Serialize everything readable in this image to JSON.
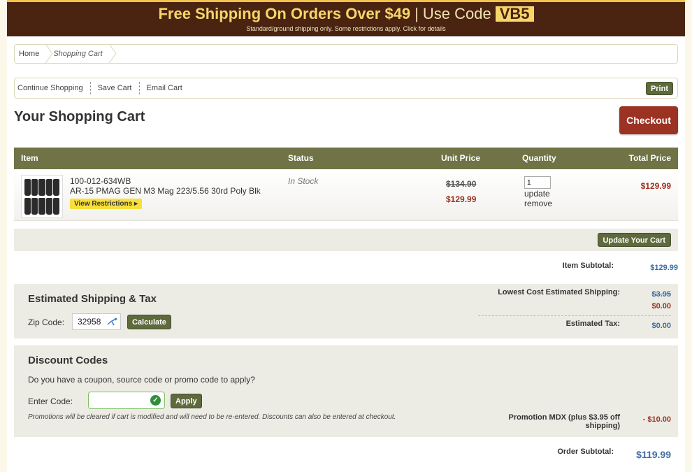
{
  "banner": {
    "headline": "Free Shipping On Orders Over $49",
    "separator": "|",
    "code_label": "Use Code",
    "code": "VB5",
    "subtext": "Standard/ground shipping only. Some restrictions apply. Click for details"
  },
  "breadcrumb": {
    "home": "Home",
    "current": "Shopping Cart"
  },
  "toolbar": {
    "continue": "Continue Shopping",
    "save": "Save Cart",
    "email": "Email Cart",
    "print": "Print"
  },
  "page_title": "Your Shopping Cart",
  "checkout_label": "Checkout",
  "table": {
    "headers": {
      "item": "Item",
      "status": "Status",
      "unit_price": "Unit Price",
      "quantity": "Quantity",
      "total_price": "Total Price"
    },
    "items": [
      {
        "sku": "100-012-634WB",
        "name": "AR-15 PMAG GEN M3 Mag 223/5.56 30rd Poly Blk",
        "restrictions_label": "View Restrictions ▸",
        "status": "In Stock",
        "original_price": "$134.90",
        "sale_price": "$129.99",
        "quantity": "1",
        "update_label": "update",
        "remove_label": "remove",
        "total_price": "$129.99"
      }
    ]
  },
  "update_cart_label": "Update Your Cart",
  "subtotal": {
    "label": "Item Subtotal:",
    "value": "$129.99"
  },
  "shipping": {
    "title": "Estimated Shipping & Tax",
    "zip_label": "Zip Code:",
    "zip_value": "32958",
    "calculate_label": "Calculate",
    "lowest_label": "Lowest Cost Estimated Shipping:",
    "original_cost": "$3.95",
    "cost": "$0.00",
    "tax_label": "Estimated Tax:",
    "tax_value": "$0.00"
  },
  "discount": {
    "title": "Discount Codes",
    "question": "Do you have a coupon, source code or promo code to apply?",
    "code_label": "Enter Code:",
    "code_value": "",
    "apply_label": "Apply",
    "note": "Promotions will be cleared if cart is modified and will need to be re-entered. Discounts can also be entered at checkout.",
    "promo_label": "Promotion MDX (plus $3.95 off shipping)",
    "promo_value": "- $10.00"
  },
  "order_subtotal": {
    "label": "Order Subtotal:",
    "value": "$119.99"
  },
  "colors": {
    "banner_bg": "#4a2410",
    "banner_text": "#f6d66a",
    "header_bg": "#6f7345",
    "button_green": "#5e6a3d",
    "checkout_red": "#9b3222",
    "price_red": "#9b3222",
    "price_blue": "#3f6da0"
  }
}
